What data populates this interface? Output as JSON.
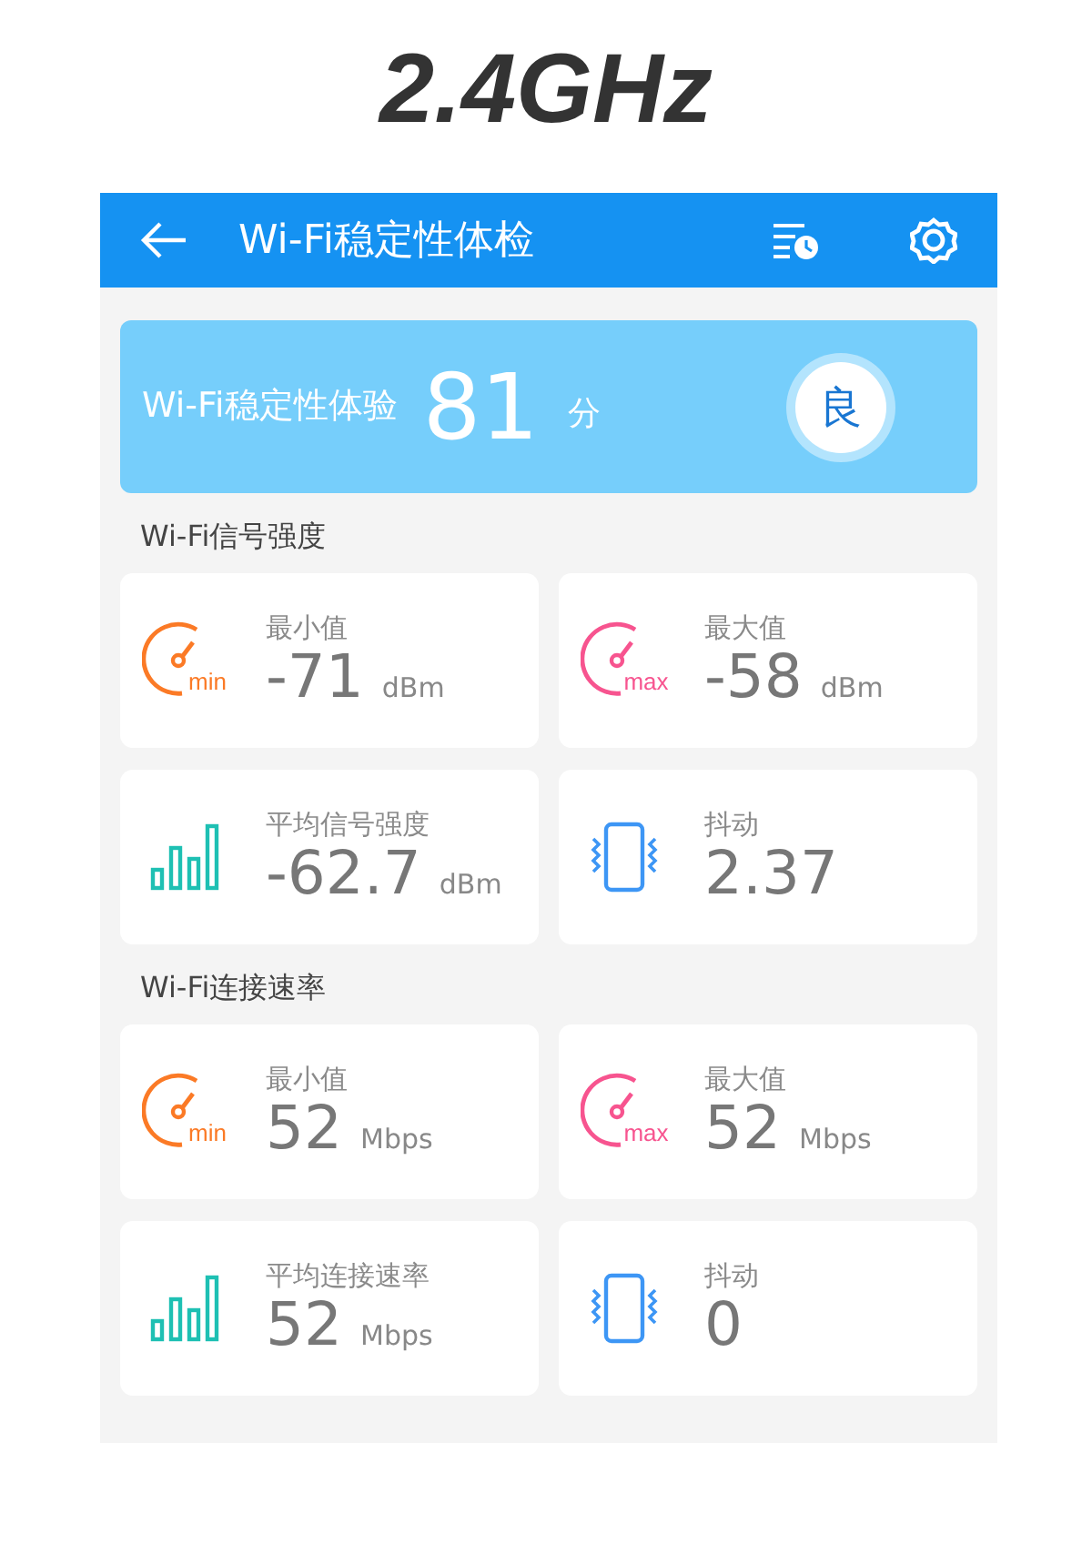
{
  "caption": "2.4GHz",
  "app_bar": {
    "title": "Wi-Fi稳定性体检"
  },
  "score": {
    "label": "Wi-Fi稳定性体验",
    "value": "81",
    "unit": "分",
    "grade": "良"
  },
  "sections": [
    {
      "title": "Wi-Fi信号强度",
      "cards": [
        {
          "kind": "min",
          "icon_label": "min",
          "label": "最小值",
          "value": "-71",
          "unit": "dBm"
        },
        {
          "kind": "max",
          "icon_label": "max",
          "label": "最大值",
          "value": "-58",
          "unit": "dBm"
        },
        {
          "kind": "average",
          "label": "平均信号强度",
          "value": "-62.7",
          "unit": "dBm"
        },
        {
          "kind": "jitter",
          "label": "抖动",
          "value": "2.37"
        }
      ]
    },
    {
      "title": "Wi-Fi连接速率",
      "cards": [
        {
          "kind": "min",
          "icon_label": "min",
          "label": "最小值",
          "value": "52",
          "unit": "Mbps"
        },
        {
          "kind": "max",
          "icon_label": "max",
          "label": "最大值",
          "value": "52",
          "unit": "Mbps"
        },
        {
          "kind": "average",
          "label": "平均连接速率",
          "value": "52",
          "unit": "Mbps"
        },
        {
          "kind": "jitter",
          "label": "抖动",
          "value": "0"
        }
      ]
    }
  ]
}
